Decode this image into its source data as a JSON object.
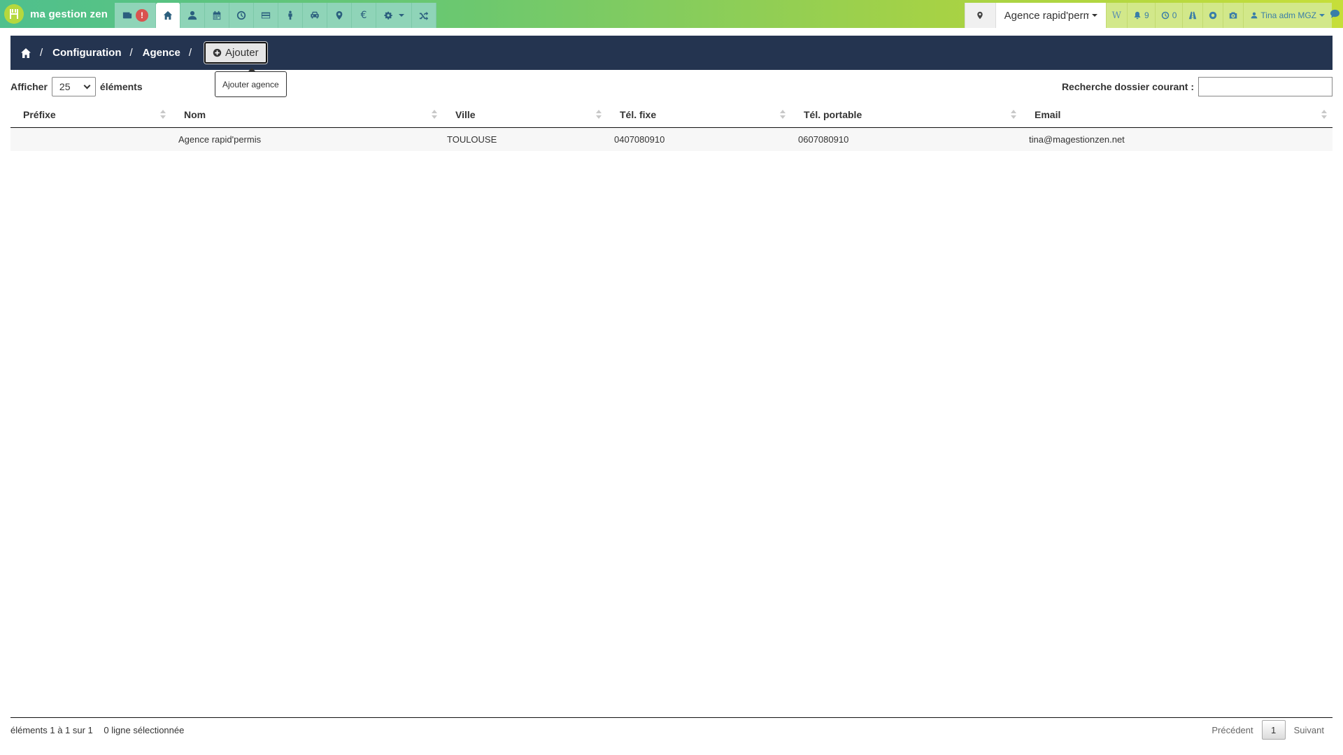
{
  "brand": {
    "name": "ma gestion zen",
    "color": "#4fc08d"
  },
  "nav": {
    "alert_badge": "!",
    "items": [
      {
        "icon": "newspaper-icon"
      },
      {
        "icon": "home-icon"
      },
      {
        "icon": "user-icon"
      },
      {
        "icon": "calendar-icon"
      },
      {
        "icon": "clock-icon"
      },
      {
        "icon": "credit-card-icon"
      },
      {
        "icon": "person-icon"
      },
      {
        "icon": "car-icon"
      },
      {
        "icon": "map-marker-icon"
      },
      {
        "icon": "euro-icon"
      },
      {
        "icon": "cogs-icon"
      },
      {
        "icon": "shuffle-icon"
      }
    ]
  },
  "topright": {
    "agency_selector": "Agence rapid'permis",
    "w_label": "W",
    "notifications_count": "9",
    "pending_count": "0",
    "user_label": "Tina adm MGZ"
  },
  "breadcrumb": {
    "items": [
      "Configuration",
      "Agence"
    ],
    "add_button": "Ajouter",
    "add_tooltip": "Ajouter agence"
  },
  "controls": {
    "show_label": "Afficher",
    "page_length": "25",
    "elements_label": "éléments",
    "search_label": "Recherche dossier courant :",
    "search_value": ""
  },
  "table": {
    "columns": [
      "Préfixe",
      "Nom",
      "Ville",
      "Tél. fixe",
      "Tél. portable",
      "Email"
    ],
    "rows": [
      [
        "",
        "Agence rapid'permis",
        "TOULOUSE",
        "0407080910",
        "0607080910",
        "tina@magestionzen.net"
      ]
    ]
  },
  "footer": {
    "info": "éléments 1 à 1 sur 1",
    "selected": "0 ligne sélectionnée",
    "prev": "Précédent",
    "page": "1",
    "next": "Suivant"
  },
  "colors": {
    "header_bg": "#243450",
    "nav_tab": "#8fd4b8",
    "alert": "#d9534f"
  }
}
